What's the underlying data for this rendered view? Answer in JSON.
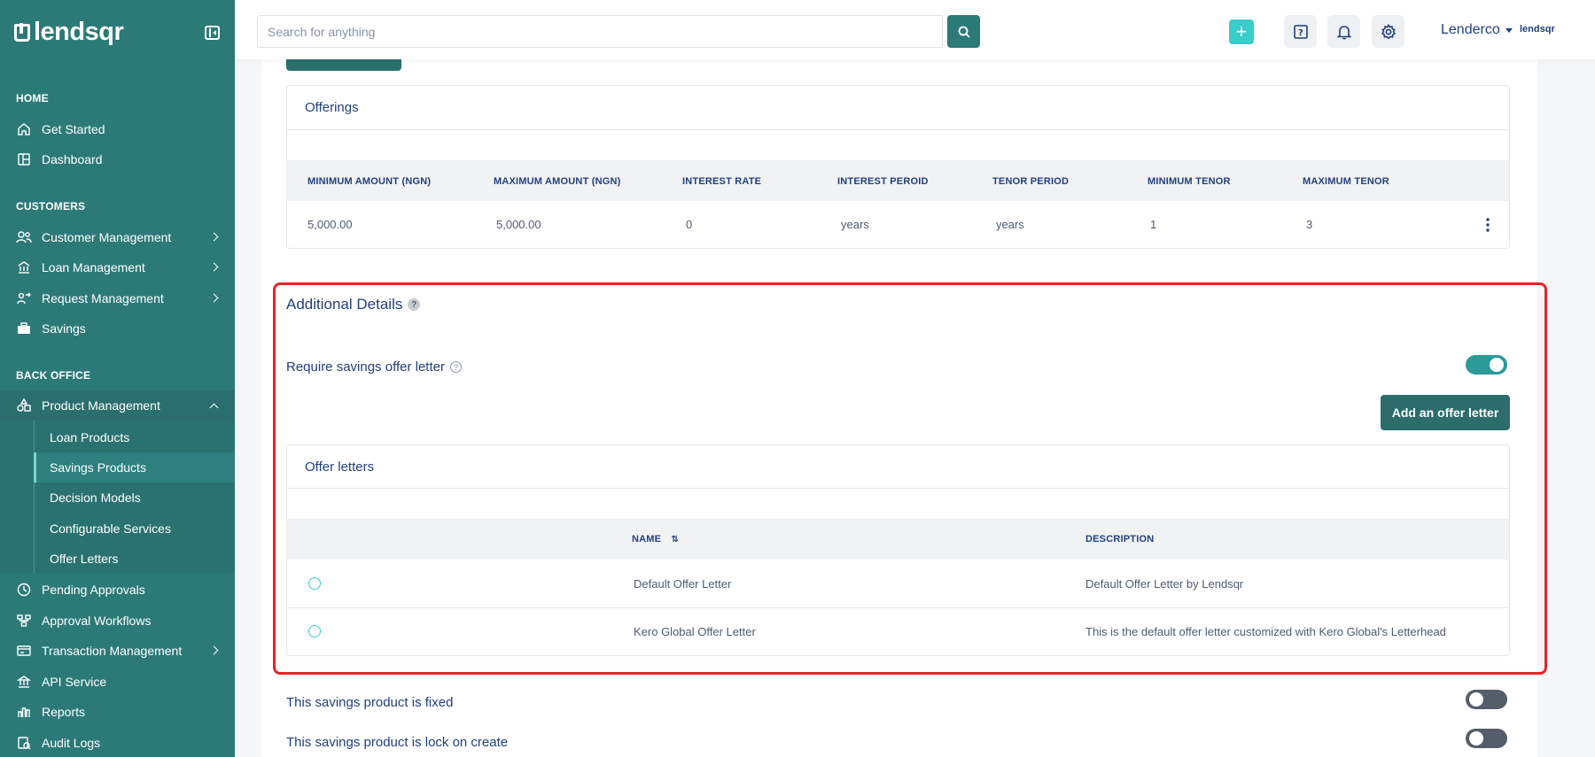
{
  "sidebar": {
    "brand": "lendsqr",
    "sections": {
      "home": "HOME",
      "customers": "CUSTOMERS",
      "back_office": "BACK OFFICE"
    },
    "items": {
      "get_started": "Get Started",
      "dashboard": "Dashboard",
      "customer_management": "Customer Management",
      "loan_management": "Loan Management",
      "request_management": "Request Management",
      "savings": "Savings",
      "product_management": "Product Management",
      "pending_approvals": "Pending Approvals",
      "approval_workflows": "Approval Workflows",
      "transaction_management": "Transaction Management",
      "api_service": "API Service",
      "reports": "Reports",
      "audit_logs": "Audit Logs"
    },
    "sub_items": {
      "loan_products": "Loan Products",
      "savings_products": "Savings Products",
      "decision_models": "Decision Models",
      "configurable_services": "Configurable Services",
      "offer_letters": "Offer Letters"
    }
  },
  "topbar": {
    "search_placeholder": "Search for anything",
    "user_name": "Lenderco",
    "mini_brand": "lendsqr"
  },
  "offerings": {
    "title": "Offerings",
    "columns": [
      "MINIMUM AMOUNT (NGN)",
      "MAXIMUM AMOUNT (NGN)",
      "INTEREST RATE",
      "INTEREST PEROID",
      "TENOR PERIOD",
      "MINIMUM TENOR",
      "MAXIMUM TENOR"
    ],
    "rows": [
      [
        "5,000.00",
        "5,000.00",
        "0",
        "years",
        "years",
        "1",
        "3"
      ]
    ]
  },
  "additional_details": {
    "title": "Additional Details",
    "require_offer_letter_label": "Require savings offer letter",
    "require_offer_letter_on": true,
    "add_offer_letter_button": "Add an offer letter",
    "offer_letters_title": "Offer letters",
    "columns": {
      "name": "NAME",
      "description": "DESCRIPTION"
    },
    "rows": [
      {
        "name": "Default Offer Letter",
        "description": "Default Offer Letter by Lendsqr"
      },
      {
        "name": "Kero Global Offer Letter",
        "description": "This is the default offer letter customized with Kero Global's Letterhead"
      }
    ]
  },
  "settings": {
    "fixed_label": "This savings product is fixed",
    "fixed_on": false,
    "lock_label": "This savings product is lock on create",
    "lock_on": false
  },
  "colors": {
    "sidebar_bg": "#2c7a78",
    "accent": "#39cdcc",
    "highlight_border": "#e5252a",
    "primary_text": "#213f7d"
  }
}
